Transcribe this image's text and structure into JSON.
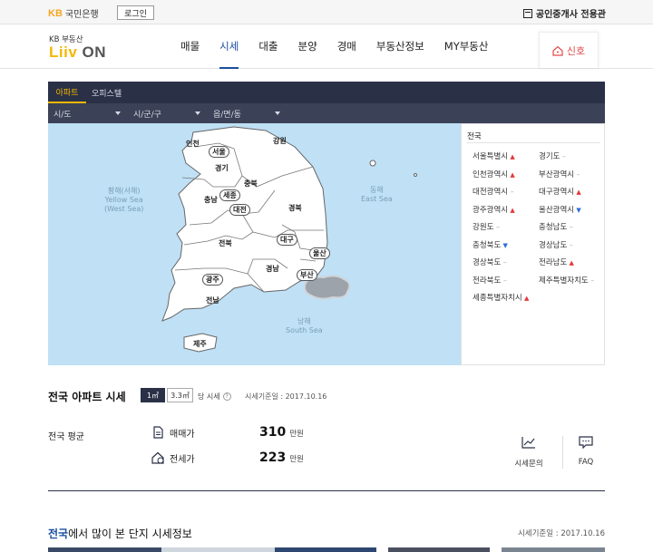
{
  "topbar": {
    "bank_mark": "KB",
    "bank_name": "국민은행",
    "login": "로그인",
    "agent_link": "공인중개사 전용관"
  },
  "brand": {
    "sub": "KB 부동산",
    "main": "Liiv",
    "main_suffix": "ON"
  },
  "nav": {
    "items": [
      "매물",
      "시세",
      "대출",
      "분양",
      "경매",
      "부동산정보",
      "MY부동산"
    ],
    "active_index": 1,
    "alert": "신호"
  },
  "panel": {
    "tabs": [
      "아파트",
      "오피스텔"
    ],
    "selects": [
      "시/도",
      "시/군/구",
      "읍/면/동"
    ]
  },
  "map": {
    "seas": {
      "west": [
        "황해(서해)",
        "Yellow Sea",
        "(West Sea)"
      ],
      "east": [
        "동해",
        "East Sea"
      ],
      "south": [
        "남해",
        "South Sea"
      ]
    },
    "provinces": {
      "incheon": "인천",
      "seoul": "서울",
      "gyeonggi": "경기",
      "gangwon": "강원",
      "chungbuk": "충북",
      "chungnam": "충남",
      "sejong": "세종",
      "daejeon": "대전",
      "gyeongbuk": "경북",
      "jeonbuk": "전북",
      "daegu": "대구",
      "ulsan": "울산",
      "gyeongnam": "경남",
      "busan": "부산",
      "gwangju": "광주",
      "jeonnam": "전남",
      "jeju": "제주"
    },
    "colors": {
      "sea": "#bfe0f5",
      "land": "#ffffff",
      "border": "#666666"
    }
  },
  "region_list": {
    "title": "전국",
    "items": [
      {
        "name": "서울특별시",
        "trend": "up"
      },
      {
        "name": "경기도",
        "trend": "flat"
      },
      {
        "name": "인천광역시",
        "trend": "up"
      },
      {
        "name": "부산광역시",
        "trend": "flat"
      },
      {
        "name": "대전광역시",
        "trend": "flat"
      },
      {
        "name": "대구광역시",
        "trend": "up"
      },
      {
        "name": "광주광역시",
        "trend": "up"
      },
      {
        "name": "울산광역시",
        "trend": "down"
      },
      {
        "name": "강원도",
        "trend": "flat"
      },
      {
        "name": "충청남도",
        "trend": "flat"
      },
      {
        "name": "충청북도",
        "trend": "down"
      },
      {
        "name": "경상남도",
        "trend": "flat"
      },
      {
        "name": "경상북도",
        "trend": "flat"
      },
      {
        "name": "전라남도",
        "trend": "up"
      },
      {
        "name": "전라북도",
        "trend": "flat"
      },
      {
        "name": "제주특별자치도",
        "trend": "flat"
      },
      {
        "name": "세종특별자치시",
        "trend": "up"
      }
    ],
    "trend_colors": {
      "up": "#e23a3a",
      "down": "#2a6fd6",
      "flat": "#aaaaaa"
    }
  },
  "summary": {
    "title": "전국 아파트 시세",
    "unit_on": "1㎡",
    "unit_off": "3.3㎡",
    "unit_tail": "당 시세",
    "help": "?",
    "base_date": "시세기준일 : 2017.10.16",
    "avg_label": "전국 평균",
    "sale_label": "매매가",
    "sale_value": "310",
    "jeonse_label": "전세가",
    "jeonse_value": "223",
    "unit_word": "만원",
    "inquiry": "시세문의",
    "faq": "FAQ"
  },
  "bottom": {
    "title_highlight": "전국",
    "title_rest": "에서 많이 본 단지 시세정보",
    "base_date": "시세기준일 : 2017.10.16"
  }
}
